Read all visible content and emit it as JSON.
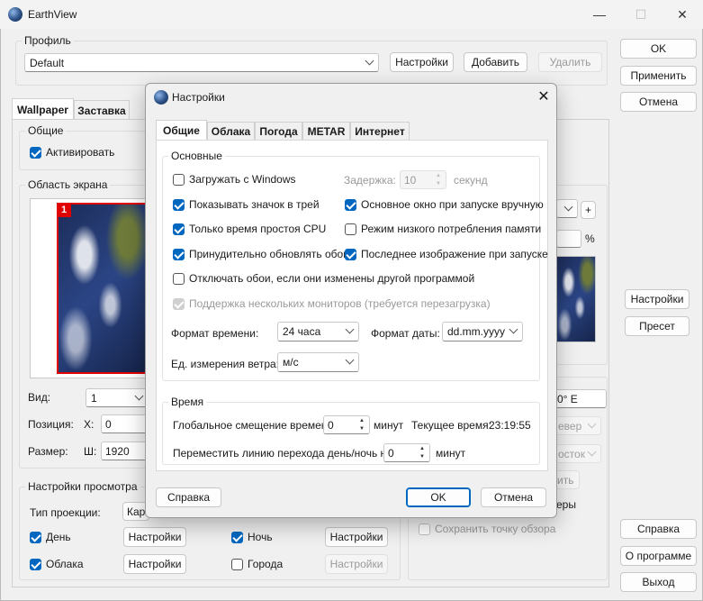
{
  "app": {
    "title": "EarthView"
  },
  "profile": {
    "group_title": "Профиль",
    "value": "Default",
    "settings_btn": "Настройки",
    "add_btn": "Добавить",
    "delete_btn": "Удалить"
  },
  "right_buttons": {
    "ok": "OK",
    "apply": "Применить",
    "cancel": "Отмена"
  },
  "main_tabs": [
    "Wallpaper",
    "Заставка"
  ],
  "general": {
    "title": "Общие",
    "activate": "Активировать"
  },
  "screen_area": {
    "title": "Область экрана",
    "monitor_number": "1",
    "view_label": "Вид:",
    "view_value": "1",
    "position_label": "Позиция:",
    "x_label": "X:",
    "x_value": "0",
    "size_label": "Размер:",
    "w_label": "Ш:",
    "w_value": "1920"
  },
  "view_settings": {
    "title": "Настройки просмотра",
    "projection_label": "Тип проекции:",
    "projection_value": "Карт",
    "day": "День",
    "night": "Ночь",
    "clouds": "Облака",
    "cities": "Города",
    "settings_btn": "Настройки"
  },
  "right_panel": {
    "plus": "+",
    "percent": "%",
    "lon_text": "0° E",
    "north_text": "евер",
    "east_text": "осток",
    "settings_btn": "Настройки",
    "preset_btn": "Пресет",
    "partial_btn": "ить",
    "partial_text": "еры",
    "save_viewpoint": "Сохранить точку обзора"
  },
  "bottom_right": {
    "help": "Справка",
    "about": "О программе",
    "exit": "Выход"
  },
  "dialog": {
    "title": "Настройки",
    "tabs": [
      "Общие",
      "Облака",
      "Погода",
      "METAR",
      "Интернет"
    ],
    "basic": {
      "title": "Основные",
      "load_windows": "Загружать с Windows",
      "delay_label": "Задержка:",
      "delay_value": "10",
      "delay_unit": "секунд",
      "show_tray": "Показывать значок в трей",
      "main_window_manual": "Основное окно при запуске вручную",
      "idle_cpu": "Только время простоя CPU",
      "low_memory": "Режим низкого потребления памяти",
      "force_update": "Принудительно обновлять обои",
      "last_image": "Последнее изображение при запуске",
      "disable_if_changed": "Отключать обои, если они изменены другой программой",
      "multi_monitor": "Поддержка нескольких мониторов (требуется перезагрузка)",
      "time_format_label": "Формат времени:",
      "time_format_value": "24 часа",
      "date_format_label": "Формат даты:",
      "date_format_value": "dd.mm.yyyy",
      "wind_label": "Ед. измерения ветра:",
      "wind_value": "м/с"
    },
    "time": {
      "title": "Время",
      "offset_label": "Глобальное смещение времени:",
      "offset_value": "0",
      "offset_unit": "минут",
      "current_label": "Текущее время:",
      "current_value": "23:19:55",
      "terminator_label": "Переместить линию перехода день/ночь на:",
      "terminator_value": "0",
      "terminator_unit": "минут"
    },
    "help_btn": "Справка",
    "ok_btn": "OK",
    "cancel_btn": "Отмена"
  }
}
